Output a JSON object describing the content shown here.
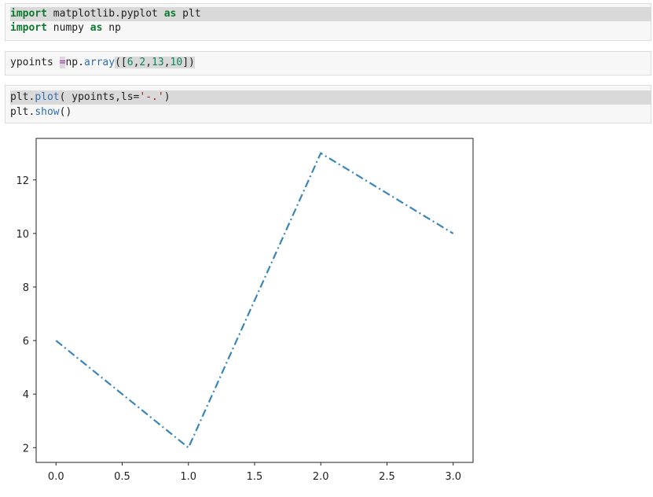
{
  "cells": [
    {
      "lines": [
        {
          "kw1": "import",
          "mod": " matplotlib.pyplot ",
          "kw2": "as",
          "alias": " plt"
        },
        {
          "kw1": "import",
          "mod": " numpy ",
          "kw2": "as",
          "alias": " np"
        }
      ]
    },
    {
      "assign": {
        "var": "ypoints ",
        "eq": "=",
        "obj": "np.",
        "fn": "array",
        "open": "([",
        "n1": "6",
        "c1": ",",
        "n2": "2",
        "c2": ",",
        "n3": "13",
        "c3": ",",
        "n4": "10",
        "close": "])"
      }
    },
    {
      "plot_line": {
        "obj": "plt.",
        "fn": "plot",
        "args": "( ypoints,ls=",
        "str": "'-.'",
        "close": ")"
      },
      "show_line": {
        "obj": "plt.",
        "fn": "show",
        "close": "()"
      }
    }
  ],
  "chart_data": {
    "type": "line",
    "x": [
      0,
      1,
      2,
      3
    ],
    "values": [
      6,
      2,
      13,
      10
    ],
    "linestyle": "-.",
    "color": "#3a86b8",
    "xlim": [
      -0.15,
      3.15
    ],
    "ylim": [
      1.45,
      13.55
    ],
    "xticks": [
      "0.0",
      "0.5",
      "1.0",
      "1.5",
      "2.0",
      "2.5",
      "3.0"
    ],
    "yticks": [
      "2",
      "4",
      "6",
      "8",
      "10",
      "12"
    ],
    "title": "",
    "xlabel": "",
    "ylabel": ""
  }
}
